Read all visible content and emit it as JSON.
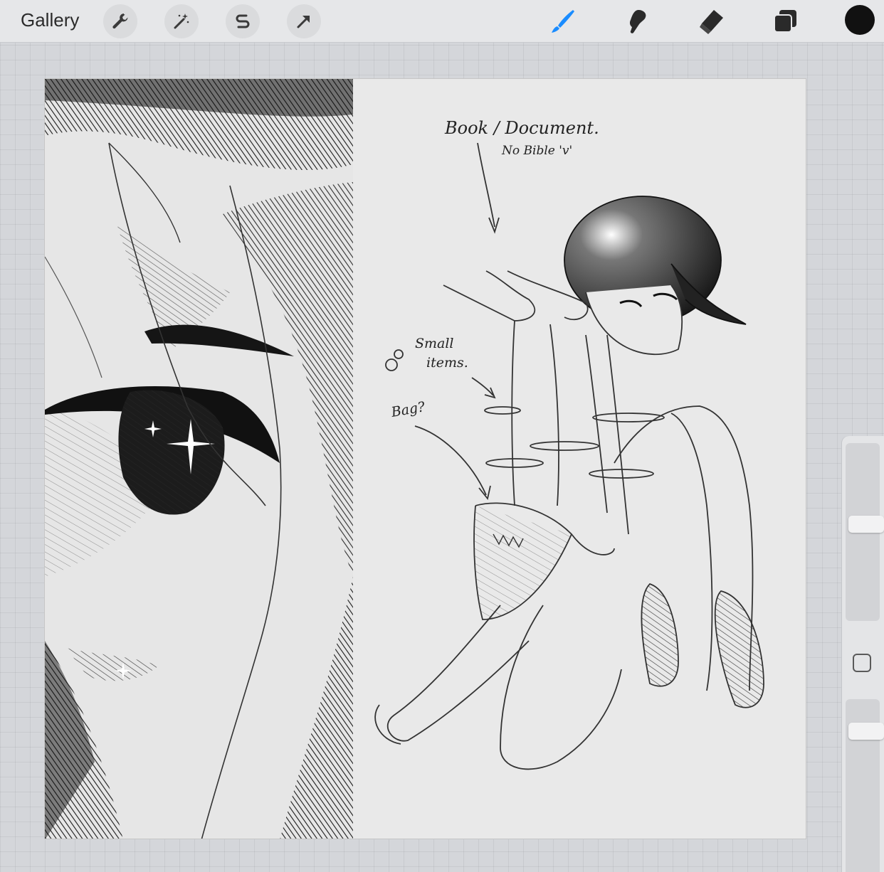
{
  "toolbar": {
    "gallery_label": "Gallery",
    "left_tools": [
      {
        "name": "actions",
        "icon": "wrench-icon"
      },
      {
        "name": "adjustments",
        "icon": "magic-wand-icon"
      },
      {
        "name": "selection",
        "icon": "selection-s-icon"
      },
      {
        "name": "transform",
        "icon": "arrow-cursor-icon"
      }
    ],
    "right_tools": [
      {
        "name": "brush",
        "icon": "brush-icon",
        "active": true
      },
      {
        "name": "smudge",
        "icon": "smudge-icon",
        "active": false
      },
      {
        "name": "eraser",
        "icon": "eraser-icon",
        "active": false
      },
      {
        "name": "layers",
        "icon": "layers-icon",
        "active": false
      }
    ],
    "current_color": "#111111",
    "active_tool_color": "#1a8cff"
  },
  "canvas": {
    "annotations": {
      "book": "Book / Document.",
      "no_bible": "No Bible 'v'",
      "small": "Small",
      "items": "items.",
      "bag": "Bag?"
    }
  },
  "sidebar": {
    "brush_size": 0.55,
    "opacity": 0.15,
    "modify_icon": "square-icon"
  }
}
